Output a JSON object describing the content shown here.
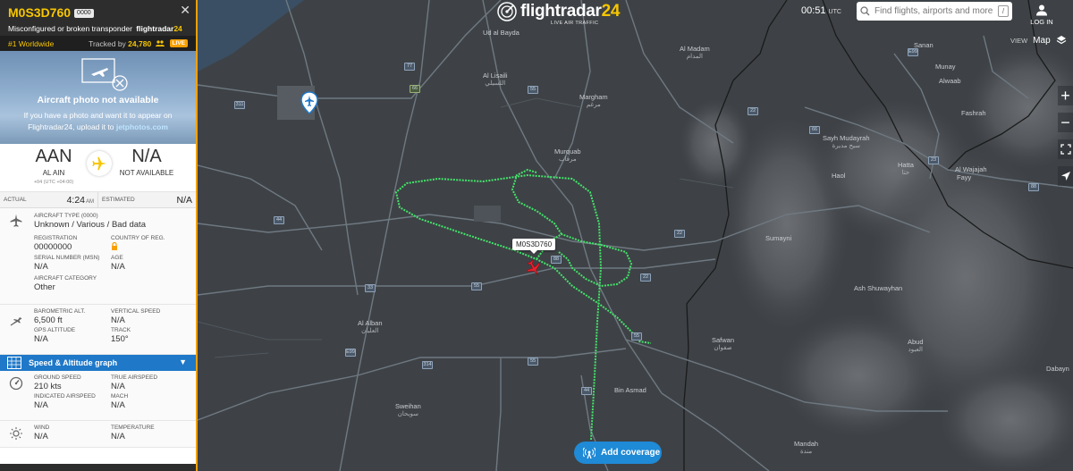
{
  "header": {
    "logo_text": "flightradar",
    "logo_num": "24",
    "logo_sub": "LIVE AIR TRAFFIC",
    "time": "00:51",
    "time_zone": "UTC",
    "search_placeholder": "Find flights, airports and more",
    "search_key": "/",
    "login_label": "LOG IN"
  },
  "view": {
    "label": "VIEW",
    "value": "Map"
  },
  "map": {
    "places": [
      {
        "name": "Ud al Bayda",
        "ar": ""
      },
      {
        "name": "Al Lisaili",
        "ar": "اللسيلي"
      },
      {
        "name": "Margham",
        "ar": "مرغم"
      },
      {
        "name": "Murquab",
        "ar": "مرقاب"
      },
      {
        "name": "Al Madam",
        "ar": "المدام"
      },
      {
        "name": "Sayh Mudayrah",
        "ar": "سيح مديرة"
      },
      {
        "name": "Hatta",
        "ar": "حتا"
      },
      {
        "name": "Haol",
        "ar": ""
      },
      {
        "name": "Al Alban",
        "ar": "العلبان"
      },
      {
        "name": "Sweihan",
        "ar": "سويحان"
      },
      {
        "name": "Bin Asmad",
        "ar": ""
      },
      {
        "name": "Safwan",
        "ar": "صفوان"
      },
      {
        "name": "Abud",
        "ar": "العبود"
      },
      {
        "name": "Ash Shuwayhan",
        "ar": ""
      },
      {
        "name": "Sumayni",
        "ar": ""
      },
      {
        "name": "Fashrah",
        "ar": ""
      },
      {
        "name": "Munay",
        "ar": ""
      },
      {
        "name": "Alwaab",
        "ar": ""
      },
      {
        "name": "Al Wajajah",
        "ar": ""
      },
      {
        "name": "Fayy",
        "ar": ""
      },
      {
        "name": "Sanan",
        "ar": ""
      },
      {
        "name": "Mandah",
        "ar": "مندة"
      },
      {
        "name": "Dabayn",
        "ar": ""
      }
    ],
    "shields": [
      "77",
      "66",
      "55",
      "311",
      "44",
      "33",
      "55",
      "22",
      "22",
      "88",
      "E99",
      "314",
      "55",
      "44",
      "55",
      "66",
      "22",
      "23",
      "E99",
      "88"
    ],
    "callout_label": "M0S3D760",
    "add_coverage_label": "Add coverage"
  },
  "panel": {
    "callsign": "M0S3D760",
    "squawk": "0000",
    "description": "Misconfigured or broken transponder",
    "brand_a": "flightradar",
    "brand_b": "24",
    "rank": "#1 Worldwide",
    "tracked_label": "Tracked by",
    "tracked_count": "24,780",
    "live": "LIVE",
    "photo_title": "Aircraft photo not available",
    "photo_text": "If you have a photo and want it to appear on Flightradar24, upload it to",
    "photo_link": "jetphotos.com",
    "origin_code": "AAN",
    "origin_name": "AL AIN",
    "origin_tz": "+04 (UTC +04:00)",
    "dest_code": "N/A",
    "dest_name": "NOT AVAILABLE",
    "actual_label": "ACTUAL",
    "actual_time": "4:24",
    "actual_ampm": "AM",
    "estimated_label": "ESTIMATED",
    "estimated_value": "N/A",
    "aircraft_type_label": "AIRCRAFT TYPE (0000)",
    "aircraft_type": "Unknown / Various / Bad data",
    "registration_label": "REGISTRATION",
    "registration": "00000000",
    "country_label": "COUNTRY OF REG.",
    "serial_label": "SERIAL NUMBER (MSN)",
    "serial": "N/A",
    "age_label": "AGE",
    "age": "N/A",
    "category_label": "AIRCRAFT CATEGORY",
    "category": "Other",
    "baro_label": "BAROMETRIC ALT.",
    "baro": "6,500 ft",
    "vs_label": "VERTICAL SPEED",
    "vs": "N/A",
    "gps_label": "GPS ALTITUDE",
    "gps": "N/A",
    "track_label": "TRACK",
    "track": "150°",
    "graph_label": "Speed & Altitude graph",
    "gs_label": "GROUND SPEED",
    "gs": "210 kts",
    "tas_label": "TRUE AIRSPEED",
    "tas": "N/A",
    "ias_label": "INDICATED AIRSPEED",
    "ias": "N/A",
    "mach_label": "MACH",
    "mach": "N/A",
    "wind_label": "WIND",
    "wind": "N/A",
    "temp_label": "TEMPERATURE",
    "temp": "N/A"
  }
}
